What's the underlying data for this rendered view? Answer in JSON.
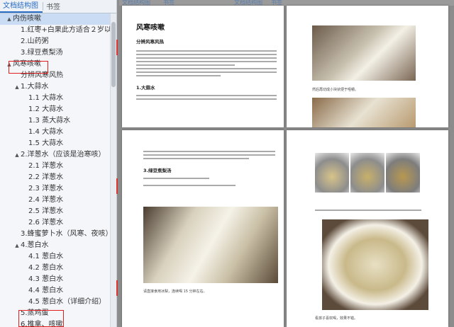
{
  "nav": {
    "tab_outline": "文档结构图",
    "tab_bookmark": "书签",
    "items": [
      {
        "label": "内伤咳嗽",
        "arrow": "▲"
      },
      {
        "label": "1.红枣+白果此方适合２岁以上"
      },
      {
        "label": "2.山药粥"
      },
      {
        "label": "3.绿豆煮梨汤"
      },
      {
        "label": "风寒咳嗽",
        "arrow": "▲"
      },
      {
        "label": "分辨风寒风热"
      },
      {
        "label": "1.大蒜水",
        "arrow": "▲"
      },
      {
        "label": "1.1 大蒜水"
      },
      {
        "label": "1.2 大蒜水"
      },
      {
        "label": "1.3 蒸大蒜水"
      },
      {
        "label": "1.4 大蒜水"
      },
      {
        "label": "1.5 大蒜水"
      },
      {
        "label": "2.洋葱水（应该是治寒咳）",
        "arrow": "▲"
      },
      {
        "label": "2.1 洋葱水"
      },
      {
        "label": "2.2 洋葱水"
      },
      {
        "label": "2.3 洋葱水"
      },
      {
        "label": "2.4 洋葱水"
      },
      {
        "label": "2.5 洋葱水"
      },
      {
        "label": "2.6 洋葱水"
      },
      {
        "label": "3.蜂蜜萝卜水（风寒、夜咳）"
      },
      {
        "label": "4.葱白水",
        "arrow": "▲"
      },
      {
        "label": "4.1 葱白水"
      },
      {
        "label": "4.2 葱白水"
      },
      {
        "label": "4.3 葱白水"
      },
      {
        "label": "4.4 葱白水"
      },
      {
        "label": "4.5 葱白水（详细介绍）"
      },
      {
        "label": "5.蒸鸡蛋"
      },
      {
        "label": "6.推拿、咳嗽"
      }
    ]
  },
  "doc": {
    "header_left": "文档结构图",
    "header_mid": "书签",
    "header_right": "文档结构图",
    "header_right2": "书签",
    "p1_title": "风寒咳嗽",
    "p1_sub": "分辨风寒风热",
    "p1_sec": "1.大蒜水",
    "p2_caption": "然后再切成小块状便于咀嚼。",
    "p3_sec": "3.绿豆煮梨汤",
    "p3_caption": "请直接食用冰梨，连续喝 15 分钟左右。",
    "p4_caption": "看孩子喜欢喝，效果不错。"
  }
}
